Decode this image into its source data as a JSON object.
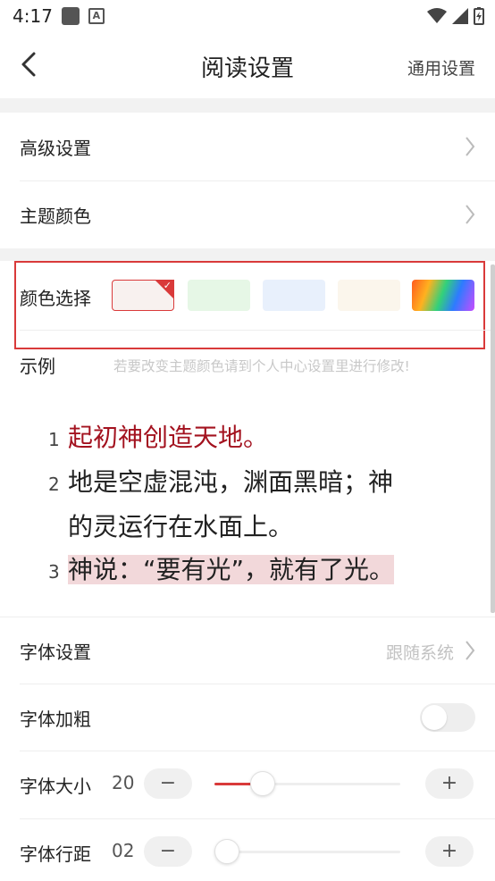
{
  "status_bar": {
    "time": "4:17"
  },
  "nav": {
    "title": "阅读设置",
    "right_action": "通用设置"
  },
  "menu": {
    "advanced": "高级设置",
    "theme_color": "主题颜色"
  },
  "color_select": {
    "label": "颜色选择",
    "swatches": [
      {
        "name": "light-red",
        "color": "#f8f1ef",
        "selected": true
      },
      {
        "name": "light-green",
        "color": "#e6f7e6",
        "selected": false
      },
      {
        "name": "light-blue",
        "color": "#e8f0fc",
        "selected": false
      },
      {
        "name": "light-beige",
        "color": "#fbf6ec",
        "selected": false
      },
      {
        "name": "rainbow",
        "color": "gradient",
        "selected": false
      }
    ]
  },
  "example": {
    "label": "示例",
    "hint": "若要改变主题颜色请到个人中心设置里进行修改!",
    "verses": [
      {
        "num": "1",
        "text": "起初神创造天地。"
      },
      {
        "num": "2",
        "text": "地是空虚混沌，渊面黑暗；神",
        "text_cont": "的灵运行在水面上。"
      },
      {
        "num": "3",
        "text": "神说：“要有光”，就有了光。"
      }
    ]
  },
  "font_settings": {
    "label": "字体设置",
    "value": "跟随系统"
  },
  "font_bold": {
    "label": "字体加粗",
    "enabled": false
  },
  "font_size": {
    "label": "字体大小",
    "value": "20",
    "minus": "−",
    "plus": "+",
    "level": 0.26
  },
  "line_spacing": {
    "label": "字体行距",
    "value": "02",
    "minus": "−",
    "plus": "+",
    "level": 0.0
  },
  "colors": {
    "accent": "#d93a3a",
    "verse_red": "#a3121f",
    "highlight": "#f2d8da"
  }
}
